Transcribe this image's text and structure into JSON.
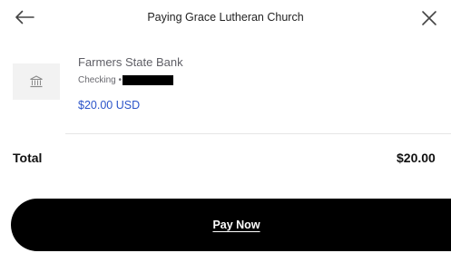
{
  "header": {
    "title": "Paying Grace Lutheran Church",
    "back_icon": "back-arrow-icon",
    "close_icon": "close-icon"
  },
  "payment_source": {
    "icon": "bank-icon",
    "bank_name": "Farmers State Bank",
    "account_type": "Checking •",
    "amount": "$20.00 USD"
  },
  "total": {
    "label": "Total",
    "value": "$20.00"
  },
  "pay_button": {
    "label": "Pay Now"
  },
  "colors": {
    "accent_blue": "#2b54c9",
    "button_bg": "#000000",
    "icon_tile_bg": "#f2f2f2"
  }
}
